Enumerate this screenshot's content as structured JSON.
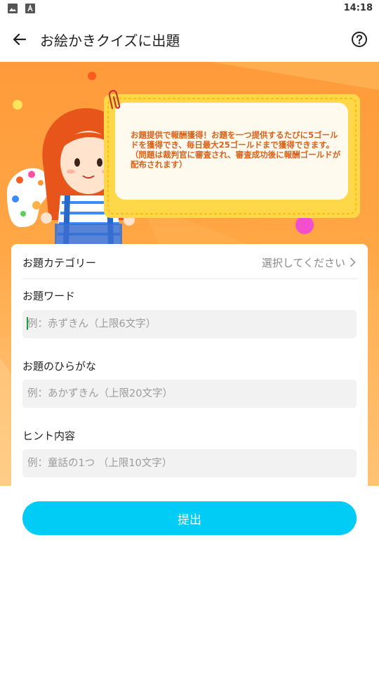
{
  "status_bar": {
    "time": "14:18",
    "icons": [
      "image-icon",
      "text-icon"
    ]
  },
  "app_bar": {
    "title": "お絵かきクイズに出題",
    "back_icon": "arrow-left-icon",
    "help_icon": "help-circle-icon"
  },
  "banner": {
    "notice": "お題提供で報酬獲得！お題を一つ提供するたびに5ゴールドを獲得でき、毎日最大25ゴールドまで獲得できます。（問題は裁判官に審査され、審査成功後に報酬ゴールドが配布されます）"
  },
  "form": {
    "category": {
      "label": "お題カテゴリー",
      "value": "選択してください"
    },
    "word": {
      "label": "お題ワード",
      "placeholder": "例：赤ずきん（上限6文字）"
    },
    "hiragana": {
      "label": "お題のひらがな",
      "placeholder": "例：あかずきん（上限20文字）"
    },
    "hint": {
      "label": "ヒント内容",
      "placeholder": "例：童話の1つ （上限10文字）"
    }
  },
  "submit_label": "提出",
  "colors": {
    "accent": "#00ccf6",
    "banner": "#ff9a3a",
    "notice_text": "#d9621a"
  }
}
